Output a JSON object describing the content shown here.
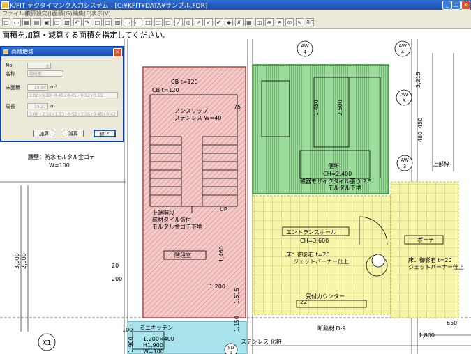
{
  "window": {
    "title": "K/FIT テクタイマンク入力システム - [C:¥KFIT¥DATA¥サンプル.FDR]",
    "minimize": "_",
    "maximize": "□",
    "close": "×"
  },
  "menu": [
    "ファイル(F)",
    "積算設定(J)",
    "面積(G)",
    "編集(E)",
    "表示(V)"
  ],
  "toolbar": {
    "buttons": [
      "□",
      "▭",
      "▦",
      "▤",
      "▣",
      "▢",
      "▧",
      "↶",
      "↷",
      "□",
      "□",
      "▨",
      "▭",
      "▭",
      "□",
      "□",
      "□",
      "╱",
      "◎",
      "↗",
      "✓",
      "✔",
      "◆",
      "✗",
      "▦",
      "◫",
      "⊕",
      "⊖",
      "⊘",
      "↖",
      "86"
    ]
  },
  "prompt": "面積を加算・減算する面積を指定してください。",
  "dialog": {
    "title": "面積増減",
    "close": "×",
    "no_label": "No",
    "no_value": "8",
    "name_label": "名称",
    "name_value": "階段室",
    "area_label": "床面積",
    "area_value": "19.90",
    "area_unit": "m²",
    "area_formula": "3.00×6.80 -0.45×0.45 - 0.52×0.53",
    "perimeter_label": "周長",
    "perimeter_value": "19.27",
    "perimeter_unit": "m",
    "perimeter_formula": "3.00+2.56+1.53+0.52+3.06+0.45+0.42+2.60",
    "add_button": "加算",
    "subtract_button": "減算",
    "close_button": "終了"
  },
  "drawing": {
    "labels": {
      "cb_120_a": "CB t=120",
      "cb_120_b": "CB t=120",
      "stairs_note_1": "ノンスリップ",
      "stairs_note_2": "ステンレス W=40",
      "wall_note_1": "腰壁：防水モルタル金ゴテ",
      "wall_note_2": "W=100",
      "floor_note_1": "上端階段",
      "floor_note_2": "磁材タイル張付",
      "floor_note_3": "モルタル金ゴテ下地",
      "room_stairs": "階段室",
      "room_wc": "便所",
      "wc_note": "CH=2.400",
      "wc_finish": "磁器モザイクタイル張り 2.5",
      "wc_finish_2": "モルタル下地",
      "room_entrance": "エントランスホール",
      "entrance_ch": "CH=3.600",
      "entrance_floor": "床：御影石 t=20",
      "entrance_floor_2": "ジェットバーナー仕上",
      "porch": "ポーチ",
      "porch_floor": "床：御影石 t=20",
      "porch_floor_2": "ジェットバーナー仕上",
      "counter": "受付カウンター",
      "kitchen": "ミニキッチン",
      "kitchen_dim": "1,200×400",
      "kitchen_dim_2": "H1,900",
      "kitchen_dim_3": "W=100",
      "ss": "ステンレス 化粧",
      "up": "UP",
      "grid_x1": "X1",
      "aw4a": "AW",
      "aw4a_n": "4",
      "aw4b": "AW",
      "aw4b_n": "4",
      "aw3a": "AW",
      "aw3a_n": "3",
      "aw3b": "AW",
      "aw3b_n": "3",
      "upper_frame": "上部枠",
      "dim_2900": "2,900",
      "dim_3900": "3,900",
      "dim_1800": "1,800",
      "dim_1200": "1,200",
      "dim_650": "650",
      "dim_3215": "3,215",
      "dim_2500": "2,500",
      "dim_1450": "1,450",
      "dim_450": "450",
      "dim_480": "480",
      "dim_1460": "1,460",
      "dim_1515": "1,515",
      "dim_1150": "1,150",
      "dim_200": "200",
      "dim_20": "20",
      "dim_75": "75",
      "dim_22": "22",
      "dim_1900": "1,900",
      "dim_100": "100",
      "spec_note": "断熱材 D-9",
      "room_sd": "SD",
      "sd_n": "1"
    }
  }
}
